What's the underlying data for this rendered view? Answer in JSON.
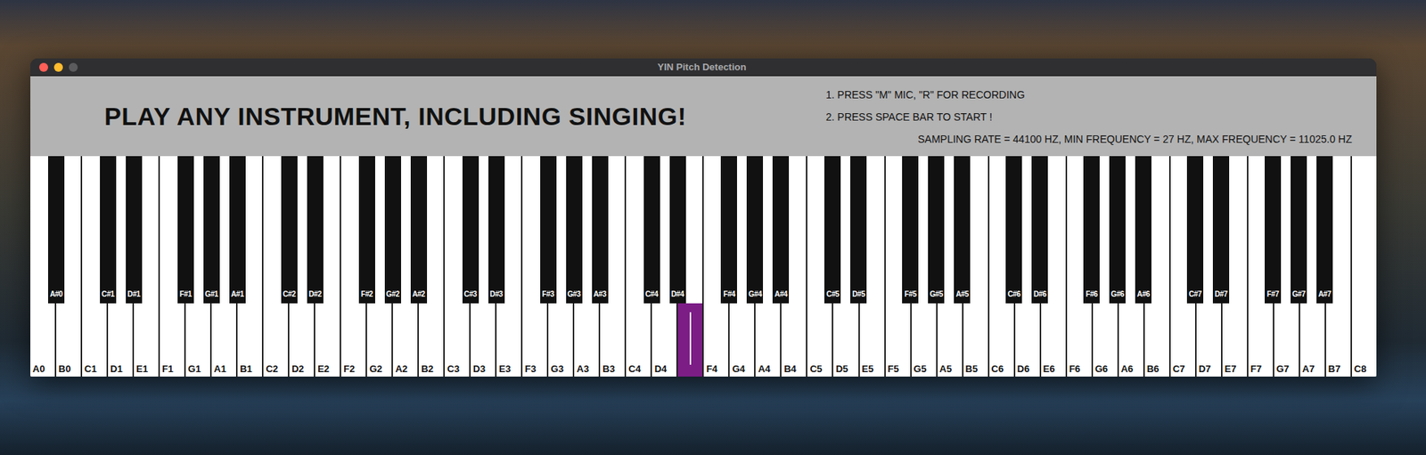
{
  "window": {
    "title": "YIN Pitch Detection"
  },
  "header": {
    "title": "PLAY ANY INSTRUMENT, INCLUDING SINGING!",
    "instructions": [
      "1. PRESS \"M\" MIC, \"R\" FOR RECORDING",
      "2. PRESS SPACE BAR TO START !"
    ],
    "settings": "SAMPLING RATE = 44100 HZ, MIN FREQUENCY = 27 HZ, MAX FREQUENCY = 11025.0 HZ"
  },
  "keyboard": {
    "white_keys": [
      {
        "label": "A0",
        "selected": false
      },
      {
        "label": "B0",
        "selected": false
      },
      {
        "label": "C1",
        "selected": false
      },
      {
        "label": "D1",
        "selected": false
      },
      {
        "label": "E1",
        "selected": false
      },
      {
        "label": "F1",
        "selected": false
      },
      {
        "label": "G1",
        "selected": false
      },
      {
        "label": "A1",
        "selected": false
      },
      {
        "label": "B1",
        "selected": false
      },
      {
        "label": "C2",
        "selected": false
      },
      {
        "label": "D2",
        "selected": false
      },
      {
        "label": "E2",
        "selected": false
      },
      {
        "label": "F2",
        "selected": false
      },
      {
        "label": "G2",
        "selected": false
      },
      {
        "label": "A2",
        "selected": false
      },
      {
        "label": "B2",
        "selected": false
      },
      {
        "label": "C3",
        "selected": false
      },
      {
        "label": "D3",
        "selected": false
      },
      {
        "label": "E3",
        "selected": false
      },
      {
        "label": "F3",
        "selected": false
      },
      {
        "label": "G3",
        "selected": false
      },
      {
        "label": "A3",
        "selected": false
      },
      {
        "label": "B3",
        "selected": false
      },
      {
        "label": "C4",
        "selected": false
      },
      {
        "label": "D4",
        "selected": false
      },
      {
        "label": "",
        "selected": true,
        "level": 0.5
      },
      {
        "label": "F4",
        "selected": false
      },
      {
        "label": "G4",
        "selected": false
      },
      {
        "label": "A4",
        "selected": false
      },
      {
        "label": "B4",
        "selected": false
      },
      {
        "label": "C5",
        "selected": false
      },
      {
        "label": "D5",
        "selected": false
      },
      {
        "label": "E5",
        "selected": false
      },
      {
        "label": "F5",
        "selected": false
      },
      {
        "label": "G5",
        "selected": false
      },
      {
        "label": "A5",
        "selected": false
      },
      {
        "label": "B5",
        "selected": false
      },
      {
        "label": "C6",
        "selected": false
      },
      {
        "label": "D6",
        "selected": false
      },
      {
        "label": "E6",
        "selected": false
      },
      {
        "label": "F6",
        "selected": false
      },
      {
        "label": "G6",
        "selected": false
      },
      {
        "label": "A6",
        "selected": false
      },
      {
        "label": "B6",
        "selected": false
      },
      {
        "label": "C7",
        "selected": false
      },
      {
        "label": "D7",
        "selected": false
      },
      {
        "label": "E7",
        "selected": false
      },
      {
        "label": "F7",
        "selected": false
      },
      {
        "label": "G7",
        "selected": false
      },
      {
        "label": "A7",
        "selected": false
      },
      {
        "label": "B7",
        "selected": false
      },
      {
        "label": "C8",
        "selected": false
      }
    ],
    "black_keys": [
      {
        "label": "A#0",
        "selected": false
      },
      {
        "label": "C#1",
        "selected": false
      },
      {
        "label": "D#1",
        "selected": false
      },
      {
        "label": "F#1",
        "selected": false
      },
      {
        "label": "G#1",
        "selected": false
      },
      {
        "label": "A#1",
        "selected": false
      },
      {
        "label": "C#2",
        "selected": false
      },
      {
        "label": "D#2",
        "selected": false
      },
      {
        "label": "F#2",
        "selected": false
      },
      {
        "label": "G#2",
        "selected": false
      },
      {
        "label": "A#2",
        "selected": false
      },
      {
        "label": "C#3",
        "selected": false
      },
      {
        "label": "D#3",
        "selected": false
      },
      {
        "label": "F#3",
        "selected": false
      },
      {
        "label": "G#3",
        "selected": false
      },
      {
        "label": "A#3",
        "selected": false
      },
      {
        "label": "C#4",
        "selected": false
      },
      {
        "label": "D#4",
        "selected": false
      },
      {
        "label": "F#4",
        "selected": false
      },
      {
        "label": "G#4",
        "selected": false
      },
      {
        "label": "A#4",
        "selected": false
      },
      {
        "label": "C#5",
        "selected": false
      },
      {
        "label": "D#5",
        "selected": false
      },
      {
        "label": "F#5",
        "selected": false
      },
      {
        "label": "G#5",
        "selected": false
      },
      {
        "label": "A#5",
        "selected": false
      },
      {
        "label": "C#6",
        "selected": false
      },
      {
        "label": "D#6",
        "selected": false
      },
      {
        "label": "F#6",
        "selected": false
      },
      {
        "label": "G#6",
        "selected": false
      },
      {
        "label": "A#6",
        "selected": false
      },
      {
        "label": "C#7",
        "selected": false
      },
      {
        "label": "D#7",
        "selected": false
      },
      {
        "label": "F#7",
        "selected": false
      },
      {
        "label": "G#7",
        "selected": false
      },
      {
        "label": "A#7",
        "selected": false
      }
    ]
  }
}
